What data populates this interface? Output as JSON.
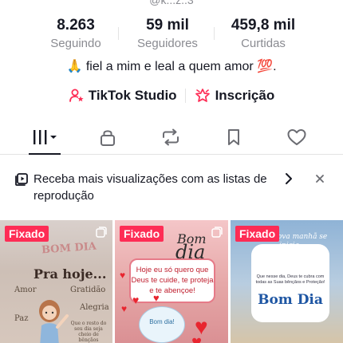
{
  "profile": {
    "handle": "@k...z..3"
  },
  "stats": [
    {
      "value": "8.263",
      "label": "Seguindo"
    },
    {
      "value": "59 mil",
      "label": "Seguidores"
    },
    {
      "value": "459,8 mil",
      "label": "Curtidas"
    }
  ],
  "bio": "🙏 fiel a mim e leal a quem amor 💯.",
  "links": {
    "studio": "TikTok Studio",
    "subscription": "Inscrição"
  },
  "tabs": [
    "videos-grid",
    "private",
    "reposts",
    "favorites",
    "liked"
  ],
  "banner": {
    "text": "Receba mais visualizações com as listas de reprodução",
    "chevron": "›",
    "close": "×"
  },
  "grid": {
    "pinned_label": "Fixado",
    "tile1": {
      "logo": "BOM DIA",
      "title": "Pra hoje...",
      "word_a": "Amor",
      "word_b": "Gratidão",
      "word_c": "Alegria",
      "word_d": "Paz",
      "small": "Que o resto do seu dia seja cheio de bênçãos"
    },
    "tile2": {
      "bom": "Bom",
      "dia": "dia",
      "card": "Hoje eu só quero que Deus te cuide, te proteja e te abençoe!",
      "heart_card": "Bom dia!"
    },
    "tile3": {
      "top": "Uma nova manhã se inicia.",
      "small": "Que nesse dia, Deus te cubra com todas as Suas bênçãos e Proteção!",
      "bom_dia": "Bom Dia"
    }
  },
  "colors": {
    "accent": "#fe2c55",
    "text": "#161823",
    "muted": "#8a8b91",
    "divider": "#e3e3e4"
  }
}
